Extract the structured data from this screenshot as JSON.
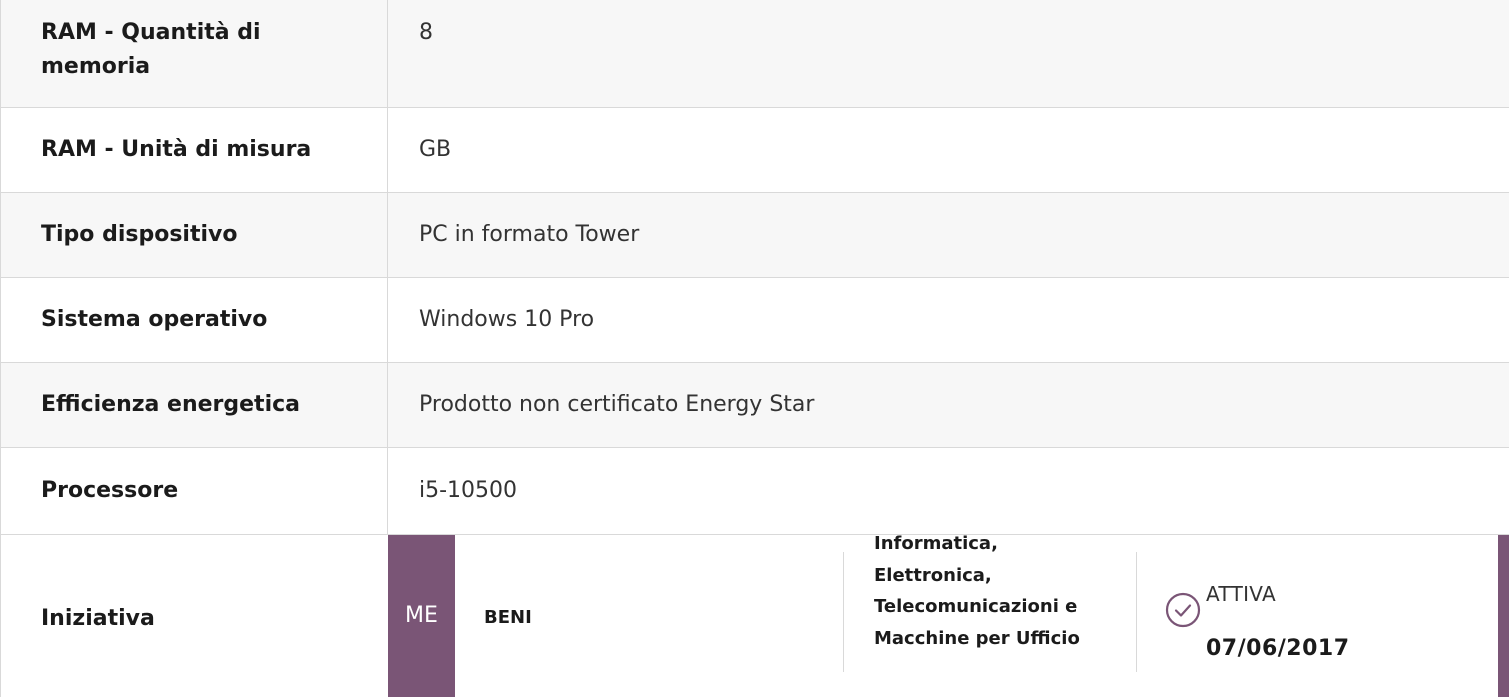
{
  "rows": [
    {
      "label": "RAM - Quantità di memoria",
      "value": "8"
    },
    {
      "label": "RAM - Unità di misura",
      "value": "GB"
    },
    {
      "label": "Tipo dispositivo",
      "value": "PC in formato Tower"
    },
    {
      "label": "Sistema operativo",
      "value": "Windows 10 Pro"
    },
    {
      "label": "Efficienza energetica",
      "value": "Prodotto non certificato Energy Star"
    },
    {
      "label": "Processore",
      "value": "i5-10500"
    }
  ],
  "initiative": {
    "label": "Iniziativa",
    "badge": "ME",
    "type": "BENI",
    "category": "Informatica, Elettronica, Telecomunicazioni e Macchine per Ufficio",
    "status": "ATTIVA",
    "date": "07/06/2017",
    "icon": "check-circle-icon",
    "accent_color": "#7a5576"
  }
}
